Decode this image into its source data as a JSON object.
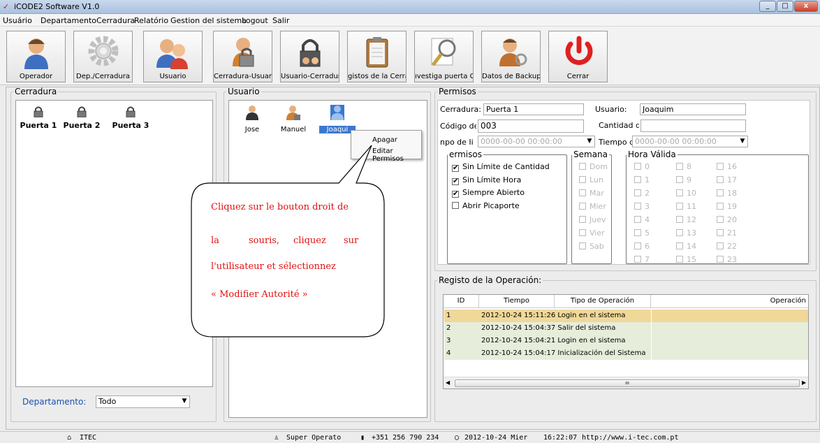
{
  "window": {
    "title": "iCODE2 Software V1.0",
    "min_icon": "minimize-icon",
    "max_icon": "maximize-icon",
    "close_icon": "close-icon",
    "close_label": "x",
    "min_label": "_",
    "max_label": "□"
  },
  "menu": [
    "Usuário",
    "Departamento",
    "Cerradura",
    "Relatório",
    "Gestion del sistema",
    "Logout",
    "Salir"
  ],
  "toolbar": [
    {
      "label": "Operador",
      "icon": "operator-icon"
    },
    {
      "label": "Dep./Cerradura",
      "icon": "gear-icon"
    },
    {
      "label": "Usuario",
      "icon": "users-icon"
    },
    {
      "label": "Cerradura-Usuario",
      "icon": "lock-user-icon"
    },
    {
      "label": "Usuario-Cerradura",
      "icon": "user-lock-icon"
    },
    {
      "label": "gistos de la Cerrad",
      "icon": "clipboard-icon"
    },
    {
      "label": "ıvestiga puerta CO",
      "icon": "magnifier-icon"
    },
    {
      "label": "Datos de Backup",
      "icon": "backup-icon"
    },
    {
      "label": "Cerrar",
      "icon": "power-icon"
    }
  ],
  "cerradura": {
    "title": "Cerradura",
    "locks": [
      "Puerta 1",
      "Puerta 2",
      "Puerta 3"
    ],
    "dept_label": "Departamento:",
    "dept_value": "Todo"
  },
  "usuario": {
    "title": "Usuario",
    "users": [
      "Jose",
      "Manuel",
      "Joaquim"
    ],
    "selected_label": "Joaqui"
  },
  "context_menu": {
    "items": [
      "Apagar",
      "Editar Permisos"
    ]
  },
  "callout": {
    "lines": [
      "Cliquez sur le bouton droit de",
      "la",
      "souris,",
      "cliquez",
      "sur",
      "l'utilisateur et sélectionnez",
      "« Modifier Autorité »"
    ]
  },
  "permisos": {
    "title": "Permisos",
    "cerradura_label": "Cerradura:",
    "cerradura_value": "Puerta 1",
    "usuario_label": "Usuario:",
    "usuario_value": "Joaquim",
    "codigo_label": "Código de U:",
    "codigo_value": "003",
    "cantidad_label": "Cantidad de",
    "cantidad_value": "",
    "inicio_label": "npo de Ii",
    "inicio_value": "0000-00-00 00:00:00",
    "fin_label": "Tiempo de F",
    "fin_value": "0000-00-00 00:00:00",
    "sub_permisos_title": "ermisos",
    "options": [
      {
        "label": "Sin Límite de Cantidad",
        "checked": true
      },
      {
        "label": "Sin Límite Hora",
        "checked": true
      },
      {
        "label": "Siempre Abierto",
        "checked": true
      },
      {
        "label": "Abrir Picaporte",
        "checked": false
      }
    ],
    "check_mark": "✔",
    "semana_title": "Semana",
    "semana": [
      "Dom",
      "Lun",
      "Mar",
      "Mier",
      "Juev",
      "Vier",
      "Sab"
    ],
    "hora_title": "Hora Válida",
    "horas": [
      "0",
      "1",
      "2",
      "3",
      "4",
      "5",
      "6",
      "7",
      "8",
      "9",
      "10",
      "11",
      "12",
      "13",
      "14",
      "15",
      "16",
      "17",
      "18",
      "19",
      "20",
      "21",
      "22",
      "23"
    ]
  },
  "registo": {
    "title": "Registo de la Operación:",
    "columns": [
      "ID",
      "Tiempo",
      "Tipo de Operación",
      "Operación"
    ],
    "rows": [
      {
        "id": "1",
        "time": "2012-10-24 15:11:26",
        "type": "Login en el sistema",
        "color": "#f0d898"
      },
      {
        "id": "2",
        "time": "2012-10-24 15:04:37",
        "type": "Salir del sistema",
        "color": "#e6edda"
      },
      {
        "id": "3",
        "time": "2012-10-24 15:04:21",
        "type": "Login en el sistema",
        "color": "#e6edda"
      },
      {
        "id": "4",
        "time": "2012-10-24 15:04:17",
        "type": "Inicialización del Sistema",
        "color": "#e6edda"
      }
    ],
    "scroll_mark": "ııı"
  },
  "status": {
    "company": "ITEC",
    "operator": "Super Operato",
    "phone": "+351 256 790 234",
    "date": "2012-10-24 Mier",
    "time": "16:22:07",
    "url": "http://www.i-tec.com.pt"
  },
  "colors": {
    "selection": "#3a78d0",
    "accent_red": "#e01010",
    "power_red": "#e02020"
  }
}
